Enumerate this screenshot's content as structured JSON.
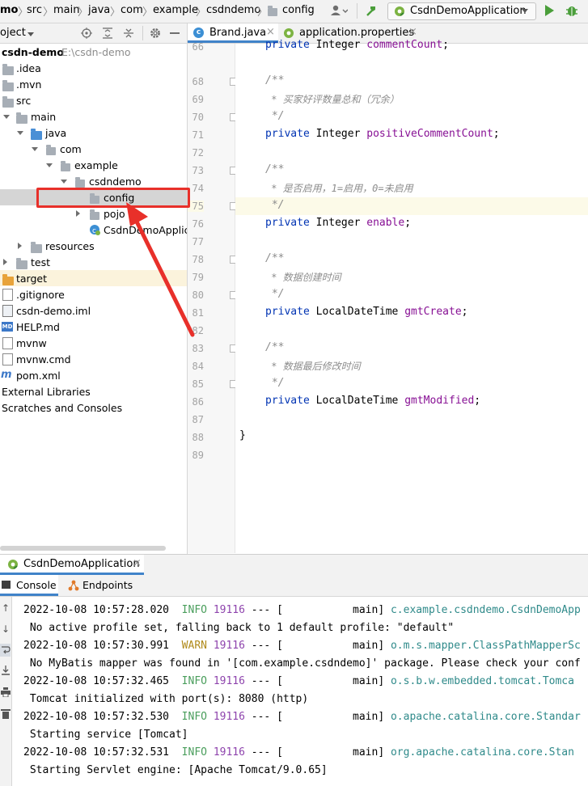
{
  "navbar": {
    "breadcrumbs": [
      "mo",
      "src",
      "main",
      "java",
      "com",
      "example",
      "csdndemo",
      "config"
    ],
    "run_config": "CsdnDemoApplication"
  },
  "project_panel": {
    "title": "oject",
    "tree": [
      {
        "label": "csdn-demo",
        "path": "E:\\csdn-demo"
      },
      {
        "label": ".idea"
      },
      {
        "label": ".mvn"
      },
      {
        "label": "src"
      },
      {
        "label": "main"
      },
      {
        "label": "java"
      },
      {
        "label": "com"
      },
      {
        "label": "example"
      },
      {
        "label": "csdndemo"
      },
      {
        "label": "config"
      },
      {
        "label": "pojo"
      },
      {
        "label": "CsdnDemoApplica"
      },
      {
        "label": "resources"
      },
      {
        "label": "test"
      },
      {
        "label": "target"
      },
      {
        "label": ".gitignore"
      },
      {
        "label": "csdn-demo.iml"
      },
      {
        "label": "HELP.md"
      },
      {
        "label": "mvnw"
      },
      {
        "label": "mvnw.cmd"
      },
      {
        "label": "pom.xml"
      },
      {
        "label": "External Libraries"
      },
      {
        "label": "Scratches and Consoles"
      }
    ]
  },
  "editor": {
    "tabs": [
      {
        "label": "Brand.java",
        "active": true
      },
      {
        "label": "application.properties",
        "active": false
      }
    ],
    "line_numbers": [
      "68",
      "69",
      "70",
      "71",
      "72",
      "73",
      "74",
      "75",
      "76",
      "77",
      "78",
      "79",
      "80",
      "81",
      "82",
      "83",
      "84",
      "85",
      "86",
      "87",
      "88",
      "89"
    ],
    "partial_line": {
      "number": "66",
      "kw": "private",
      "type": "Integer",
      "field": "commentCount",
      "end": ";"
    },
    "code": {
      "c1_open": "/**",
      "c1_text": " * 买家好评数量总和（冗余）",
      "c1_close": " */",
      "d1_kw": "private",
      "d1_type": "Integer",
      "d1_field": "positiveCommentCount",
      "d1_end": ";",
      "c2_open": "/**",
      "c2_text": " * 是否启用，1=启用，0=未启用",
      "c2_close": " */",
      "d2_kw": "private",
      "d2_type": "Integer",
      "d2_field": "enable",
      "d2_end": ";",
      "c3_open": "/**",
      "c3_text": " * 数据创建时间",
      "c3_close": " */",
      "d3_kw": "private",
      "d3_type": "LocalDateTime",
      "d3_field": "gmtCreate",
      "d3_end": ";",
      "c4_open": "/**",
      "c4_text": " * 数据最后修改时间",
      "c4_close": " */",
      "d4_kw": "private",
      "d4_type": "LocalDateTime",
      "d4_field": "gmtModified",
      "d4_end": ";",
      "close_brace": "}"
    }
  },
  "run_panel": {
    "tab_label": "CsdnDemoApplication",
    "console_tab": "Console",
    "endpoints_tab": "Endpoints",
    "log": [
      {
        "time": "2022-10-08 10:57:28.020",
        "level": "INFO",
        "pid": "19116",
        "sep": "---",
        "thread": "[           main]",
        "logger": "c.example.csdndemo.CsdnDemoApp",
        "message": " No active profile set, falling back to 1 default profile: \"default\""
      },
      {
        "time": "2022-10-08 10:57:30.991",
        "level": "WARN",
        "pid": "19116",
        "sep": "---",
        "thread": "[           main]",
        "logger": "o.m.s.mapper.ClassPathMapperSc",
        "message": " No MyBatis mapper was found in '[com.example.csdndemo]' package. Please check your conf"
      },
      {
        "time": "2022-10-08 10:57:32.465",
        "level": "INFO",
        "pid": "19116",
        "sep": "---",
        "thread": "[           main]",
        "logger": "o.s.b.w.embedded.tomcat.Tomca",
        "message": " Tomcat initialized with port(s): 8080 (http)"
      },
      {
        "time": "2022-10-08 10:57:32.530",
        "level": "INFO",
        "pid": "19116",
        "sep": "---",
        "thread": "[           main]",
        "logger": "o.apache.catalina.core.Standar",
        "message": " Starting service [Tomcat]"
      },
      {
        "time": "2022-10-08 10:57:32.531",
        "level": "INFO",
        "pid": "19116",
        "sep": "---",
        "thread": "[           main]",
        "logger": "org.apache.catalina.core.Stan",
        "message": " Starting Servlet engine: [Apache Tomcat/9.0.65]"
      }
    ]
  },
  "colors": {
    "highlight_box": "#e8302a",
    "selected_row": "#d5d5d5",
    "caret_line": "#fcfae8"
  }
}
